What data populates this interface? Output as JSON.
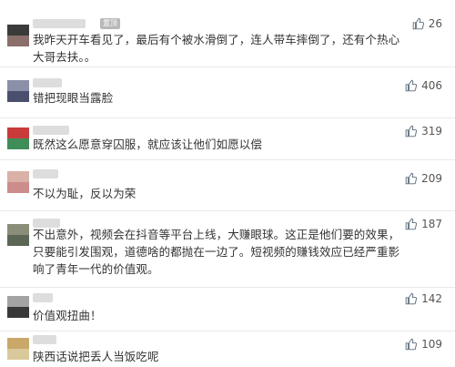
{
  "comments": [
    {
      "text": "我昨天开车看见了，最后有个被水滑倒了，连人带车摔倒了，还有个热心大哥去扶。。",
      "likes": "26",
      "badge": "置顶",
      "avatar_colors": [
        "#3b3b3b",
        "#8a6f6a"
      ]
    },
    {
      "text": "错把现眼当露脸",
      "likes": "406",
      "avatar_colors": [
        "#8c8fa8",
        "#4b4f6e"
      ]
    },
    {
      "text": "既然这么愿意穿囚服，就应该让他们如愿以偿",
      "likes": "319",
      "avatar_colors": [
        "#c93b3b",
        "#3f8d59"
      ]
    },
    {
      "text": "不以为耻，反以为荣",
      "likes": "209",
      "avatar_colors": [
        "#d9b1a6",
        "#cd8c8c"
      ]
    },
    {
      "text": "不出意外，视频会在抖音等平台上线，大赚眼球。这正是他们要的效果，只要能引发围观，道德啥的都抛在一边了。短视频的赚钱效应已经严重影响了青年一代的价值观。",
      "likes": "187",
      "avatar_colors": [
        "#8a8e78",
        "#5c6655"
      ]
    },
    {
      "text": "价值观扭曲！",
      "likes": "142",
      "avatar_colors": [
        "#a3a3a3",
        "#383838"
      ]
    },
    {
      "text": "陕西话说把丢人当饭吃呢",
      "likes": "109",
      "avatar_colors": [
        "#c9a86a",
        "#d9c99a"
      ]
    }
  ],
  "icons": {
    "like": "thumbs-up-icon"
  }
}
